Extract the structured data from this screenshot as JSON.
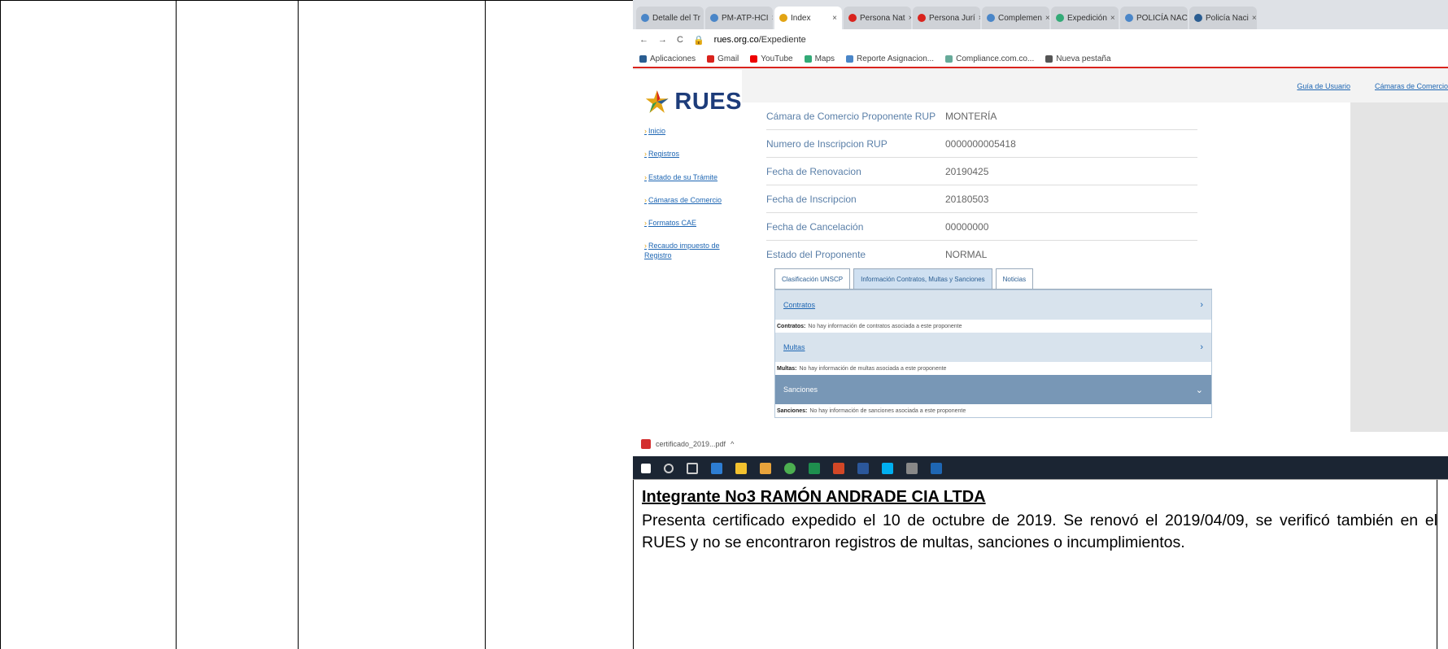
{
  "browser": {
    "tabs": [
      "Detalle del Tr",
      "PM-ATP-HCI",
      "Index",
      "Persona Nat",
      "Persona Jurí",
      "Complemen",
      "Expedición",
      "POLICÍA NAC",
      "Policía Naci"
    ],
    "active_tab_index": 2,
    "url_prefix": "rues.org.co",
    "url_path": "/Expediente",
    "bookmarks": [
      "Aplicaciones",
      "Gmail",
      "YouTube",
      "Maps",
      "Reporte Asignacion...",
      "Compliance.com.co...",
      "Nueva pestaña"
    ]
  },
  "rues": {
    "logo_text": "RUES",
    "top_links": [
      "Guía de Usuario",
      "Cámaras de Comercio"
    ],
    "nav": [
      "Inicio",
      "Registros",
      "Estado de su Trámite",
      "Cámaras de Comercio",
      "Formatos CAE",
      "Recaudo impuesto de Registro"
    ],
    "fields": [
      {
        "label": "Cámara de Comercio Proponente RUP",
        "value": "MONTERÍA"
      },
      {
        "label": "Numero de Inscripcion RUP",
        "value": "0000000005418"
      },
      {
        "label": "Fecha de Renovacion",
        "value": "20190425"
      },
      {
        "label": "Fecha de Inscripcion",
        "value": "20180503"
      },
      {
        "label": "Fecha de Cancelación",
        "value": "00000000"
      },
      {
        "label": "Estado del Proponente",
        "value": "NORMAL"
      }
    ],
    "info_tabs": [
      "Clasificación UNSCP",
      "Información Contratos, Multas y Sanciones",
      "Noticias"
    ],
    "sections": [
      {
        "title": "Contratos",
        "note_label": "Contratos:",
        "note": "No hay información de contratos asociada a este proponente"
      },
      {
        "title": "Multas",
        "note_label": "Multas:",
        "note": "No hay información de multas asociada a este proponente"
      },
      {
        "title": "Sanciones",
        "note_label": "Sanciones:",
        "note": "No hay información de sanciones asociada a este proponente"
      }
    ],
    "download_file": "certificado_2019...pdf"
  },
  "document": {
    "heading": "Integrante No3 RAMÓN ANDRADE CIA LTDA",
    "paragraph": "Presenta certificado expedido el 10 de octubre de 2019. Se renovó el 2019/04/09, se verificó también en el RUES y no se encontraron registros de multas, sanciones o incumplimientos."
  },
  "colors": {
    "rues_blue": "#1d3c7a",
    "link_blue": "#1e66b3",
    "bookmark_red_line": "#d9231d",
    "taskbar": "#1b2533"
  }
}
